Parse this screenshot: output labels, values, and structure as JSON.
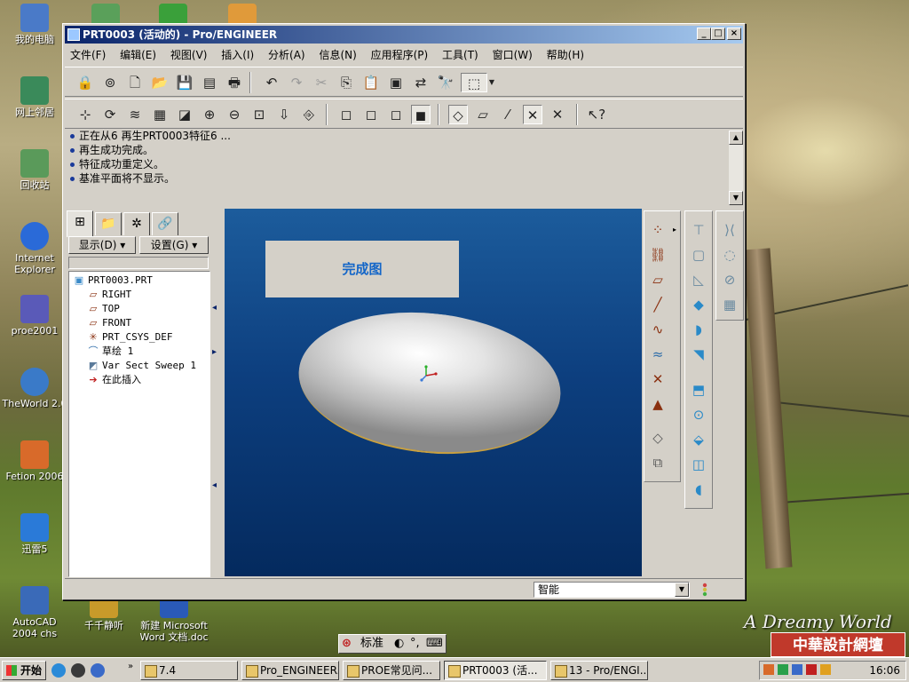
{
  "desktop": {
    "icons": [
      {
        "label": "我的电脑",
        "color": "#4a7ac8"
      },
      {
        "label": "网上邻居",
        "color": "#3a8a5a"
      },
      {
        "label": "回收站",
        "color": "#5a9a5a"
      },
      {
        "label": "Internet Explorer",
        "color": "#2a6ad8"
      },
      {
        "label": "proe2001",
        "color": "#5a5ab8"
      },
      {
        "label": "TheWorld 2.0",
        "color": "#3a7ac8"
      },
      {
        "label": "Fetion 2006",
        "color": "#d86a2a"
      },
      {
        "label": "迅雷5",
        "color": "#2a7ad8"
      },
      {
        "label": "AutoCAD 2004 chs",
        "color": "#3a6ab8"
      },
      {
        "label": "千千静听",
        "color": "#c89a2a"
      },
      {
        "label": "新建 Microsoft Word 文档.doc",
        "color": "#2a5ab8"
      }
    ],
    "watermark": "A Dreamy World",
    "site_logo": "中華設計網壇"
  },
  "window": {
    "title": "PRT0003 (活动的) - Pro/ENGINEER",
    "menu": [
      "文件(F)",
      "编辑(E)",
      "视图(V)",
      "插入(I)",
      "分析(A)",
      "信息(N)",
      "应用程序(P)",
      "工具(T)",
      "窗口(W)",
      "帮助(H)"
    ],
    "messages": [
      "正在从6 再生PRT0003特征6 ...",
      "再生成功完成。",
      "特征成功重定义。",
      "基准平面将不显示。"
    ],
    "nav": {
      "show_label": "显示(D)",
      "settings_label": "设置(G)"
    },
    "tree": [
      {
        "label": "PRT0003.PRT",
        "icon": "part-icon"
      },
      {
        "label": "RIGHT",
        "icon": "datum-plane-icon"
      },
      {
        "label": "TOP",
        "icon": "datum-plane-icon"
      },
      {
        "label": "FRONT",
        "icon": "datum-plane-icon"
      },
      {
        "label": "PRT_CSYS_DEF",
        "icon": "csys-icon"
      },
      {
        "label": "草绘 1",
        "icon": "sketch-icon"
      },
      {
        "label": "Var Sect Sweep 1",
        "icon": "sweep-icon"
      },
      {
        "label": "在此插入",
        "icon": "insert-here-icon"
      }
    ],
    "viewport_note": "完成图",
    "status_filter": "智能"
  },
  "ime": {
    "mode": "标准"
  },
  "taskbar": {
    "start": "开始",
    "tasks": [
      {
        "label": "7.4",
        "active": false
      },
      {
        "label": "Pro_ENGINEER...",
        "active": false
      },
      {
        "label": "PROE常见问...",
        "active": false
      },
      {
        "label": "PRT0003 (活...",
        "active": true
      },
      {
        "label": "13 - Pro/ENGI...",
        "active": false
      }
    ],
    "clock": "16:06"
  }
}
